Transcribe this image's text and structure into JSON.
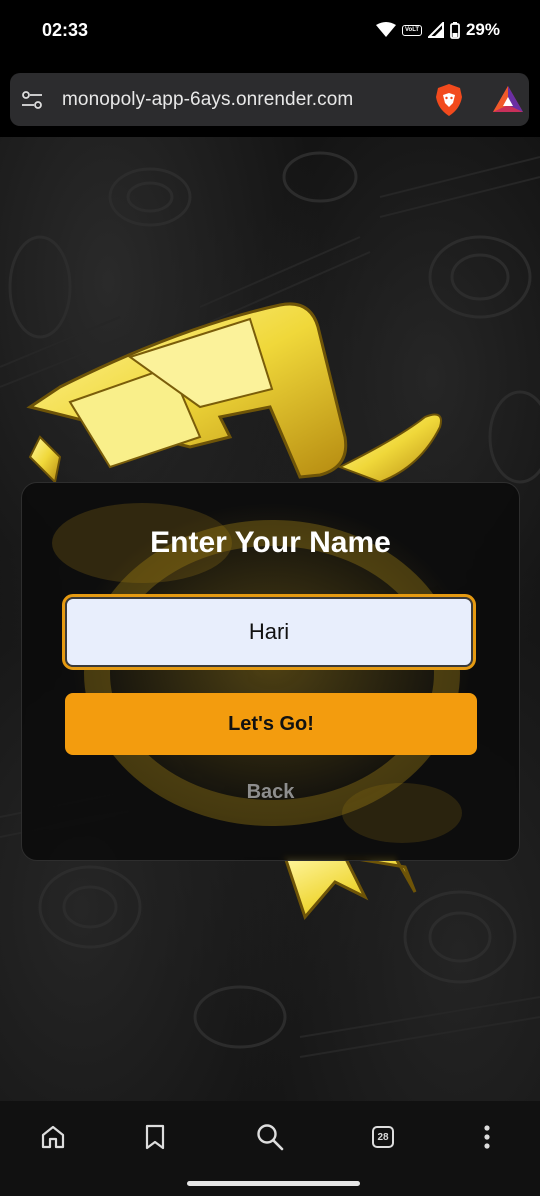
{
  "status": {
    "time": "02:33",
    "network": "VoLTE",
    "battery": "29%"
  },
  "browser": {
    "url": "monopoly-app-6ays.onrender.com",
    "tab_count": "28"
  },
  "modal": {
    "title": "Enter Your Name",
    "name_value": "Hari",
    "submit_label": "Let's Go!",
    "back_label": "Back"
  },
  "colors": {
    "accent": "#f39c0e",
    "input_bg": "#e8eefc",
    "gold": "#f5e04a"
  }
}
